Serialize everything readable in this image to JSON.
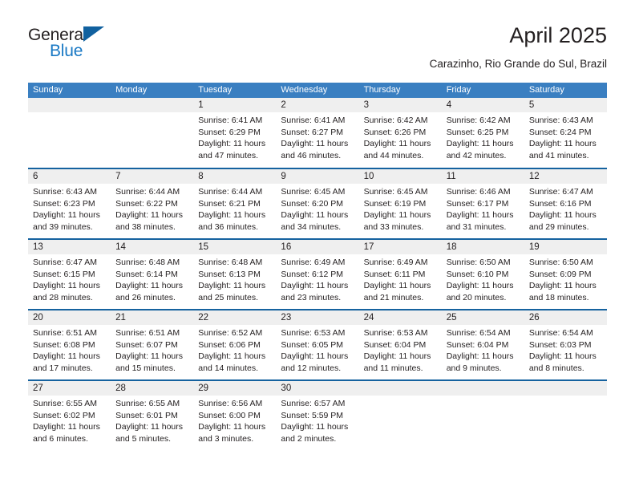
{
  "brand": {
    "name_part1": "General",
    "name_part2": "Blue",
    "accent_color": "#1878c4",
    "triangle_color": "#11619f"
  },
  "header": {
    "month_title": "April 2025",
    "location": "Carazinho, Rio Grande do Sul, Brazil"
  },
  "calendar": {
    "header_bg": "#3a7fc1",
    "row_divider_color": "#15629f",
    "daynum_bg": "#efefef",
    "weekdays": [
      "Sunday",
      "Monday",
      "Tuesday",
      "Wednesday",
      "Thursday",
      "Friday",
      "Saturday"
    ],
    "weeks": [
      [
        {
          "day": "",
          "lines": []
        },
        {
          "day": "",
          "lines": []
        },
        {
          "day": "1",
          "lines": [
            "Sunrise: 6:41 AM",
            "Sunset: 6:29 PM",
            "Daylight: 11 hours",
            "and 47 minutes."
          ]
        },
        {
          "day": "2",
          "lines": [
            "Sunrise: 6:41 AM",
            "Sunset: 6:27 PM",
            "Daylight: 11 hours",
            "and 46 minutes."
          ]
        },
        {
          "day": "3",
          "lines": [
            "Sunrise: 6:42 AM",
            "Sunset: 6:26 PM",
            "Daylight: 11 hours",
            "and 44 minutes."
          ]
        },
        {
          "day": "4",
          "lines": [
            "Sunrise: 6:42 AM",
            "Sunset: 6:25 PM",
            "Daylight: 11 hours",
            "and 42 minutes."
          ]
        },
        {
          "day": "5",
          "lines": [
            "Sunrise: 6:43 AM",
            "Sunset: 6:24 PM",
            "Daylight: 11 hours",
            "and 41 minutes."
          ]
        }
      ],
      [
        {
          "day": "6",
          "lines": [
            "Sunrise: 6:43 AM",
            "Sunset: 6:23 PM",
            "Daylight: 11 hours",
            "and 39 minutes."
          ]
        },
        {
          "day": "7",
          "lines": [
            "Sunrise: 6:44 AM",
            "Sunset: 6:22 PM",
            "Daylight: 11 hours",
            "and 38 minutes."
          ]
        },
        {
          "day": "8",
          "lines": [
            "Sunrise: 6:44 AM",
            "Sunset: 6:21 PM",
            "Daylight: 11 hours",
            "and 36 minutes."
          ]
        },
        {
          "day": "9",
          "lines": [
            "Sunrise: 6:45 AM",
            "Sunset: 6:20 PM",
            "Daylight: 11 hours",
            "and 34 minutes."
          ]
        },
        {
          "day": "10",
          "lines": [
            "Sunrise: 6:45 AM",
            "Sunset: 6:19 PM",
            "Daylight: 11 hours",
            "and 33 minutes."
          ]
        },
        {
          "day": "11",
          "lines": [
            "Sunrise: 6:46 AM",
            "Sunset: 6:17 PM",
            "Daylight: 11 hours",
            "and 31 minutes."
          ]
        },
        {
          "day": "12",
          "lines": [
            "Sunrise: 6:47 AM",
            "Sunset: 6:16 PM",
            "Daylight: 11 hours",
            "and 29 minutes."
          ]
        }
      ],
      [
        {
          "day": "13",
          "lines": [
            "Sunrise: 6:47 AM",
            "Sunset: 6:15 PM",
            "Daylight: 11 hours",
            "and 28 minutes."
          ]
        },
        {
          "day": "14",
          "lines": [
            "Sunrise: 6:48 AM",
            "Sunset: 6:14 PM",
            "Daylight: 11 hours",
            "and 26 minutes."
          ]
        },
        {
          "day": "15",
          "lines": [
            "Sunrise: 6:48 AM",
            "Sunset: 6:13 PM",
            "Daylight: 11 hours",
            "and 25 minutes."
          ]
        },
        {
          "day": "16",
          "lines": [
            "Sunrise: 6:49 AM",
            "Sunset: 6:12 PM",
            "Daylight: 11 hours",
            "and 23 minutes."
          ]
        },
        {
          "day": "17",
          "lines": [
            "Sunrise: 6:49 AM",
            "Sunset: 6:11 PM",
            "Daylight: 11 hours",
            "and 21 minutes."
          ]
        },
        {
          "day": "18",
          "lines": [
            "Sunrise: 6:50 AM",
            "Sunset: 6:10 PM",
            "Daylight: 11 hours",
            "and 20 minutes."
          ]
        },
        {
          "day": "19",
          "lines": [
            "Sunrise: 6:50 AM",
            "Sunset: 6:09 PM",
            "Daylight: 11 hours",
            "and 18 minutes."
          ]
        }
      ],
      [
        {
          "day": "20",
          "lines": [
            "Sunrise: 6:51 AM",
            "Sunset: 6:08 PM",
            "Daylight: 11 hours",
            "and 17 minutes."
          ]
        },
        {
          "day": "21",
          "lines": [
            "Sunrise: 6:51 AM",
            "Sunset: 6:07 PM",
            "Daylight: 11 hours",
            "and 15 minutes."
          ]
        },
        {
          "day": "22",
          "lines": [
            "Sunrise: 6:52 AM",
            "Sunset: 6:06 PM",
            "Daylight: 11 hours",
            "and 14 minutes."
          ]
        },
        {
          "day": "23",
          "lines": [
            "Sunrise: 6:53 AM",
            "Sunset: 6:05 PM",
            "Daylight: 11 hours",
            "and 12 minutes."
          ]
        },
        {
          "day": "24",
          "lines": [
            "Sunrise: 6:53 AM",
            "Sunset: 6:04 PM",
            "Daylight: 11 hours",
            "and 11 minutes."
          ]
        },
        {
          "day": "25",
          "lines": [
            "Sunrise: 6:54 AM",
            "Sunset: 6:04 PM",
            "Daylight: 11 hours",
            "and 9 minutes."
          ]
        },
        {
          "day": "26",
          "lines": [
            "Sunrise: 6:54 AM",
            "Sunset: 6:03 PM",
            "Daylight: 11 hours",
            "and 8 minutes."
          ]
        }
      ],
      [
        {
          "day": "27",
          "lines": [
            "Sunrise: 6:55 AM",
            "Sunset: 6:02 PM",
            "Daylight: 11 hours",
            "and 6 minutes."
          ]
        },
        {
          "day": "28",
          "lines": [
            "Sunrise: 6:55 AM",
            "Sunset: 6:01 PM",
            "Daylight: 11 hours",
            "and 5 minutes."
          ]
        },
        {
          "day": "29",
          "lines": [
            "Sunrise: 6:56 AM",
            "Sunset: 6:00 PM",
            "Daylight: 11 hours",
            "and 3 minutes."
          ]
        },
        {
          "day": "30",
          "lines": [
            "Sunrise: 6:57 AM",
            "Sunset: 5:59 PM",
            "Daylight: 11 hours",
            "and 2 minutes."
          ]
        },
        {
          "day": "",
          "lines": []
        },
        {
          "day": "",
          "lines": []
        },
        {
          "day": "",
          "lines": []
        }
      ]
    ]
  }
}
